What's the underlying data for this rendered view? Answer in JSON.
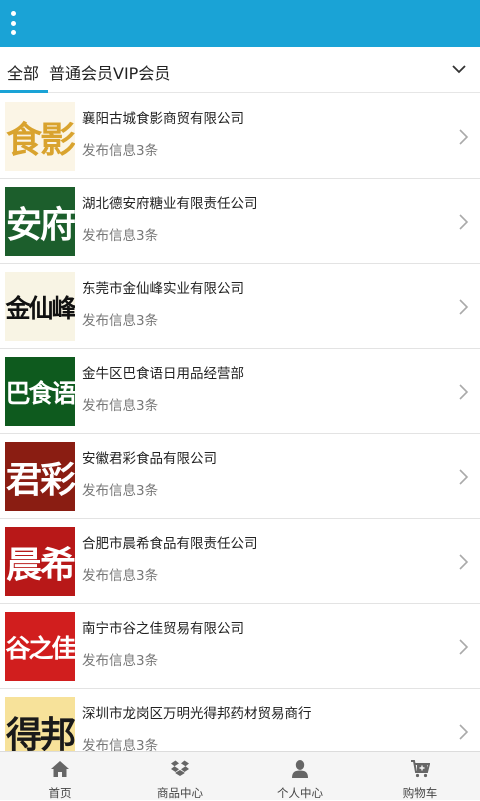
{
  "tabs": {
    "all": "全部",
    "regular": "普通会员",
    "vip": "VIP会员"
  },
  "items": [
    {
      "thumb_text": "食影",
      "thumb_bg": "#fbf5e6",
      "thumb_fg": "#d9a32e",
      "name": "襄阳古城食影商贸有限公司",
      "info": "发布信息3条"
    },
    {
      "thumb_text": "安府",
      "thumb_bg": "#1c5e2c",
      "thumb_fg": "#ffffff",
      "name": "湖北德安府糖业有限责任公司",
      "info": "发布信息3条"
    },
    {
      "thumb_text": "金仙峰",
      "thumb_bg": "#f8f4e4",
      "thumb_fg": "#111111",
      "name": "东莞市金仙峰实业有限公司",
      "info": "发布信息3条"
    },
    {
      "thumb_text": "巴食语",
      "thumb_bg": "#0e5a1e",
      "thumb_fg": "#ffffff",
      "name": "金牛区巴食语日用品经营部",
      "info": "发布信息3条"
    },
    {
      "thumb_text": "君彩",
      "thumb_bg": "#8a1d12",
      "thumb_fg": "#ffffff",
      "name": "安徽君彩食品有限公司",
      "info": "发布信息3条"
    },
    {
      "thumb_text": "晨希",
      "thumb_bg": "#b81818",
      "thumb_fg": "#ffffff",
      "name": "合肥市晨希食品有限责任公司",
      "info": "发布信息3条"
    },
    {
      "thumb_text": "谷之佳",
      "thumb_bg": "#d11e1e",
      "thumb_fg": "#ffffff",
      "name": "南宁市谷之佳贸易有限公司",
      "info": "发布信息3条"
    },
    {
      "thumb_text": "得邦",
      "thumb_bg": "#f7e29a",
      "thumb_fg": "#1a1a1a",
      "name": "深圳市龙岗区万明光得邦药材贸易商行",
      "info": "发布信息3条"
    }
  ],
  "bottom_nav": [
    {
      "label": "首页",
      "icon": "home-icon"
    },
    {
      "label": "商品中心",
      "icon": "dropbox-icon"
    },
    {
      "label": "个人中心",
      "icon": "user-icon"
    },
    {
      "label": "购物车",
      "icon": "cart-icon"
    }
  ],
  "colors": {
    "accent": "#1aa3d6"
  }
}
